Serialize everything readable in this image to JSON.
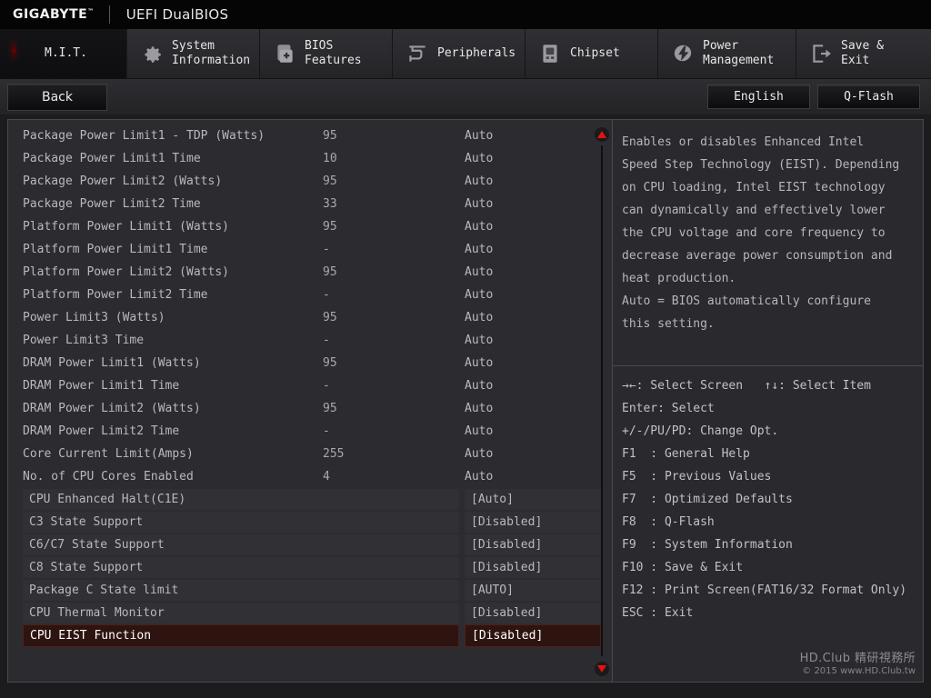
{
  "titlebar": {
    "brand": "GIGABYTE",
    "trademark": "™",
    "suite": "UEFI DualBIOS"
  },
  "tabs": [
    {
      "id": "mit",
      "label": "M.I.T.",
      "icon": "red-circle-icon",
      "active": true
    },
    {
      "id": "sysinfo",
      "label": "System\nInformation",
      "icon": "gear-icon",
      "active": false
    },
    {
      "id": "bios",
      "label": "BIOS\nFeatures",
      "icon": "chip-plus-icon",
      "active": false
    },
    {
      "id": "peripheral",
      "label": "Peripherals",
      "icon": "peripherals-icon",
      "active": false
    },
    {
      "id": "chipset",
      "label": "Chipset",
      "icon": "chipset-icon",
      "active": false
    },
    {
      "id": "power",
      "label": "Power\nManagement",
      "icon": "power-bolt-icon",
      "active": false
    },
    {
      "id": "saveexit",
      "label": "Save & Exit",
      "icon": "exit-arrow-icon",
      "active": false
    }
  ],
  "toolbar": {
    "back_label": "Back",
    "language_label": "English",
    "qflash_label": "Q-Flash"
  },
  "settings": {
    "rows": [
      {
        "label": "Package Power Limit1 - TDP (Watts)",
        "num": "95",
        "value": "Auto",
        "type": "plain",
        "selected": false
      },
      {
        "label": "Package Power Limit1 Time",
        "num": "10",
        "value": "Auto",
        "type": "plain",
        "selected": false
      },
      {
        "label": "Package Power Limit2 (Watts)",
        "num": "95",
        "value": "Auto",
        "type": "plain",
        "selected": false
      },
      {
        "label": "Package Power Limit2 Time",
        "num": "33",
        "value": "Auto",
        "type": "plain",
        "selected": false
      },
      {
        "label": "Platform Power Limit1 (Watts)",
        "num": "95",
        "value": "Auto",
        "type": "plain",
        "selected": false
      },
      {
        "label": "Platform Power Limit1 Time",
        "num": "-",
        "value": "Auto",
        "type": "plain",
        "selected": false
      },
      {
        "label": "Platform Power Limit2 (Watts)",
        "num": "95",
        "value": "Auto",
        "type": "plain",
        "selected": false
      },
      {
        "label": "Platform Power Limit2 Time",
        "num": "-",
        "value": "Auto",
        "type": "plain",
        "selected": false
      },
      {
        "label": "Power Limit3 (Watts)",
        "num": "95",
        "value": "Auto",
        "type": "plain",
        "selected": false
      },
      {
        "label": "Power Limit3 Time",
        "num": "-",
        "value": "Auto",
        "type": "plain",
        "selected": false
      },
      {
        "label": "DRAM Power Limit1 (Watts)",
        "num": "95",
        "value": "Auto",
        "type": "plain",
        "selected": false
      },
      {
        "label": "DRAM Power Limit1 Time",
        "num": "-",
        "value": "Auto",
        "type": "plain",
        "selected": false
      },
      {
        "label": "DRAM Power Limit2 (Watts)",
        "num": "95",
        "value": "Auto",
        "type": "plain",
        "selected": false
      },
      {
        "label": "DRAM Power Limit2 Time",
        "num": "-",
        "value": "Auto",
        "type": "plain",
        "selected": false
      },
      {
        "label": "Core Current Limit(Amps)",
        "num": "255",
        "value": "Auto",
        "type": "plain",
        "selected": false
      },
      {
        "label": "No. of CPU Cores Enabled",
        "num": "4",
        "value": "Auto",
        "type": "plain",
        "selected": false
      },
      {
        "label": "CPU Enhanced Halt(C1E)",
        "num": "",
        "value": "[Auto]",
        "type": "option",
        "selected": false
      },
      {
        "label": "C3 State Support",
        "num": "",
        "value": "[Disabled]",
        "type": "option",
        "selected": false
      },
      {
        "label": "C6/C7 State Support",
        "num": "",
        "value": "[Disabled]",
        "type": "option",
        "selected": false
      },
      {
        "label": "C8 State Support",
        "num": "",
        "value": "[Disabled]",
        "type": "option",
        "selected": false
      },
      {
        "label": "Package C State limit",
        "num": "",
        "value": "[AUTO]",
        "type": "option",
        "selected": false
      },
      {
        "label": "CPU Thermal Monitor",
        "num": "",
        "value": "[Disabled]",
        "type": "option",
        "selected": false
      },
      {
        "label": "CPU EIST Function",
        "num": "",
        "value": "[Disabled]",
        "type": "option",
        "selected": true
      }
    ],
    "scroll_up_icon": "scroll-up-arrow-icon",
    "scroll_down_icon": "scroll-down-arrow-icon"
  },
  "help": {
    "description_lines": [
      "Enables or disables Enhanced Intel",
      "Speed Step Technology (EIST). Depending",
      "on CPU loading, Intel EIST technology",
      "can dynamically and effectively lower",
      "the CPU voltage and core frequency to",
      "decrease average power consumption and",
      "heat production.",
      "Auto = BIOS automatically configure",
      "this setting."
    ],
    "key_lines": [
      "→←: Select Screen   ↑↓: Select Item",
      "Enter: Select",
      "+/-/PU/PD: Change Opt.",
      "F1  : General Help",
      "F5  : Previous Values",
      "F7  : Optimized Defaults",
      "F8  : Q-Flash",
      "F9  : System Information",
      "F10 : Save & Exit",
      "F12 : Print Screen(FAT16/32 Format Only)",
      "ESC : Exit"
    ]
  },
  "watermark": {
    "line1": "HD.Club 精研視務所",
    "line2": "© 2015  www.HD.Club.tw"
  },
  "colors": {
    "accent_red": "#e81010",
    "selection_bg": "#2e1410",
    "panel_bg": "#2a2a2e"
  }
}
